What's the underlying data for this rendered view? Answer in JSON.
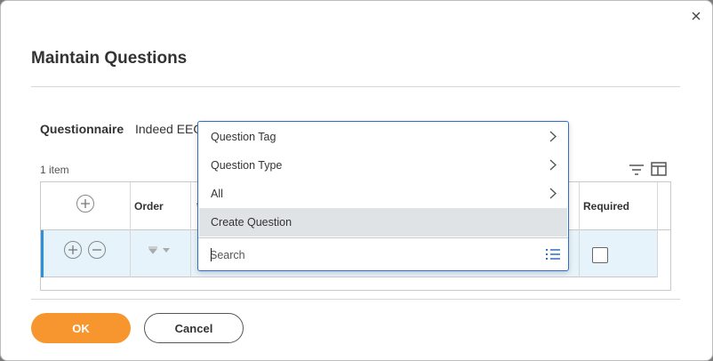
{
  "dialog": {
    "title": "Maintain Questions",
    "close_icon": "close-icon"
  },
  "questionnaire": {
    "label": "Questionnaire",
    "value": "Indeed EEO"
  },
  "grid": {
    "item_count": "1 item",
    "columns": {
      "order": "Order",
      "question_partial": "*",
      "required": "Required"
    },
    "toolbar_icons": [
      "filter-icon",
      "column-layout-icon"
    ],
    "rows": [
      {
        "required": false
      }
    ]
  },
  "dropdown": {
    "items": [
      {
        "label": "Question Tag",
        "has_submenu": true
      },
      {
        "label": "Question Type",
        "has_submenu": true
      },
      {
        "label": "All",
        "has_submenu": true
      },
      {
        "label": "Create Question",
        "has_submenu": false,
        "highlighted": true
      }
    ],
    "search": {
      "placeholder": "Search",
      "value": ""
    },
    "list_icon": "list-icon"
  },
  "footer": {
    "ok_label": "OK",
    "cancel_label": "Cancel"
  },
  "colors": {
    "primary_button": "#f7962f",
    "selection_accent": "#2f8fd8",
    "row_highlight": "#e6f3fa",
    "dropdown_border": "#2f6fc6"
  }
}
